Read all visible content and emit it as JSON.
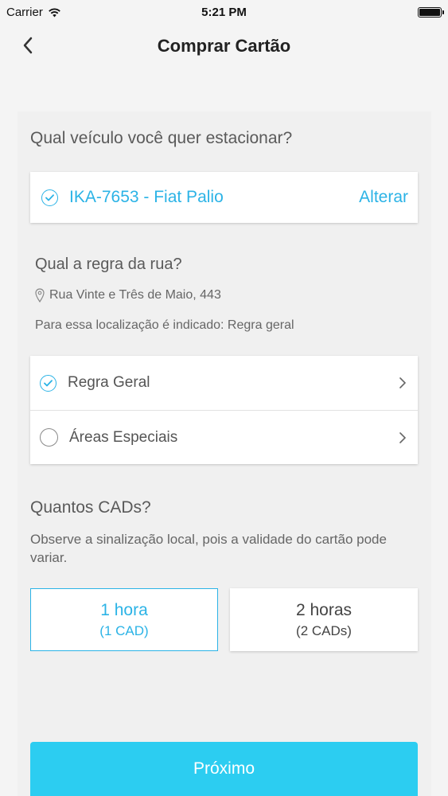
{
  "status_bar": {
    "carrier": "Carrier",
    "time": "5:21 PM"
  },
  "nav": {
    "title": "Comprar Cartão"
  },
  "vehicle_section": {
    "question": "Qual veículo você quer estacionar?",
    "vehicle": "IKA-7653 - Fiat Palio",
    "change_label": "Alterar"
  },
  "rule_section": {
    "question": "Qual a regra da rua?",
    "address": "Rua Vinte e Três de Maio, 443",
    "indicated": "Para essa localização é indicado: Regra geral",
    "options": [
      {
        "label": "Regra Geral",
        "selected": true
      },
      {
        "label": "Áreas Especiais",
        "selected": false
      }
    ]
  },
  "cad_section": {
    "question": "Quantos CADs?",
    "note": "Observe a sinalização local, pois a validade do cartão pode variar.",
    "options": [
      {
        "main": "1 hora",
        "sub": "(1 CAD)",
        "selected": true
      },
      {
        "main": "2 horas",
        "sub": "(2 CADs)",
        "selected": false
      }
    ]
  },
  "next_button": {
    "label": "Próximo"
  },
  "colors": {
    "accent": "#2bb3e6",
    "button": "#2ccdf1",
    "background": "#f4f4f4"
  }
}
